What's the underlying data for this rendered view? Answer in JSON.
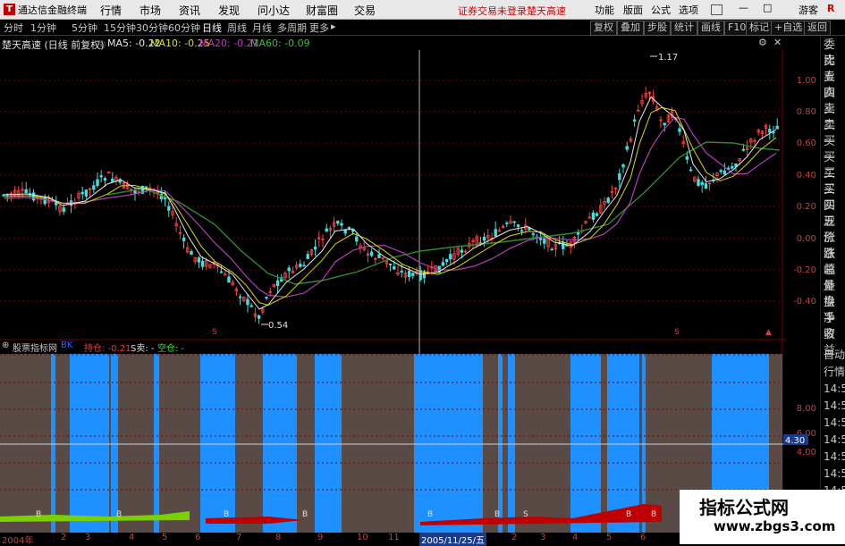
{
  "titlebar": {
    "app_title": "通达信金融终端",
    "logo": "T",
    "menu": [
      "行情",
      "市场",
      "资讯",
      "发现",
      "问小达",
      "财富圈",
      "交易"
    ],
    "red_links": [
      "证券交易未登录",
      "楚天高速"
    ],
    "right_menu": [
      "功能",
      "版面",
      "公式",
      "选项"
    ],
    "guest": "游客"
  },
  "toolbar": {
    "periods": [
      "分时",
      "1分钟",
      "5分钟",
      "15分钟",
      "30分钟",
      "60分钟",
      "日线",
      "周线",
      "月线",
      "多周期",
      "更多"
    ],
    "active": "日线",
    "buttons": [
      "复权",
      "叠加",
      "步股",
      "统计",
      "画线",
      "F10",
      "标记",
      "+自选",
      "返回"
    ]
  },
  "info": {
    "stock": "楚天高速 (日线 前复权)",
    "ma5": "MA5: -0.22",
    "ma10": "MA10: -0.25",
    "ma20": "MA20: -0.21",
    "ma60": "MA60: -0.09"
  },
  "axis": {
    "upper": [
      "1.00",
      "0.80",
      "0.60",
      "0.40",
      "0.20",
      "0.00",
      "-0.20",
      "-0.40"
    ],
    "lower": [
      "8.00",
      "6.00",
      "4.00"
    ],
    "cursor_value": "4.30"
  },
  "annotations": {
    "high": "1.17",
    "low": "0.54"
  },
  "rightpanel": [
    "委比",
    "卖五",
    "卖四",
    "卖三",
    "卖二",
    "卖一",
    "买一",
    "买二",
    "买三",
    "买四",
    "买五",
    "现价",
    "涨跌",
    "涨幅",
    "总量",
    "外盘",
    "换手",
    "净资",
    "收益"
  ],
  "rightpanel_lower": [
    "自动",
    "行情",
    "14:50",
    "14:50",
    "14:50",
    "14:50",
    "14:50",
    "14:50",
    "14:50",
    "14:50"
  ],
  "lower_info": {
    "title": "股票指标网",
    "tag": "持仓: -0.21",
    "s_sell": "S卖: -",
    "empty": "空仓: -"
  },
  "dates": [
    "2004年",
    "2",
    "3",
    "4",
    "5",
    "6",
    "7",
    "8",
    "9",
    "10",
    "11",
    "2005/11/25/五",
    "2",
    "3",
    "4",
    "5",
    "6"
  ],
  "watermark": {
    "line1": "指标公式网",
    "line2": "www.zbgs3.com"
  },
  "colors": {
    "bg": "#000000",
    "grid": "#7a0000",
    "axis_text": "#c84040",
    "blue_band": "#1e90ff",
    "brown_band": "#5a4a46",
    "ma60": "#2e8b2e",
    "ma20": "#b040b0"
  }
}
